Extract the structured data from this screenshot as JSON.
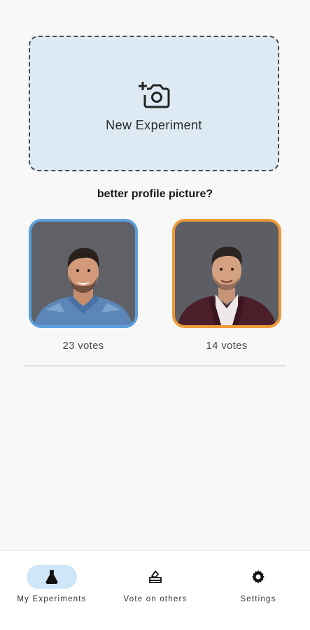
{
  "new_experiment": {
    "label": "New Experiment",
    "icon": "add-photo-camera-icon"
  },
  "experiment": {
    "question": "better profile picture?",
    "options": [
      {
        "votes_label": "23 votes",
        "accent": "#5b9fdc",
        "image": "man-denim-shirt-photo"
      },
      {
        "votes_label": "14 votes",
        "accent": "#ed9a3a",
        "image": "man-maroon-blazer-photo"
      }
    ]
  },
  "nav": {
    "items": [
      {
        "label": "My Experiments",
        "icon": "flask-icon",
        "active": true
      },
      {
        "label": "Vote on others",
        "icon": "ballot-box-icon",
        "active": false
      },
      {
        "label": "Settings",
        "icon": "gear-icon",
        "active": false
      }
    ],
    "active_color": "#cfe6f9"
  },
  "colors": {
    "background": "#f8f8f8",
    "card_background": "#deeaf3"
  }
}
